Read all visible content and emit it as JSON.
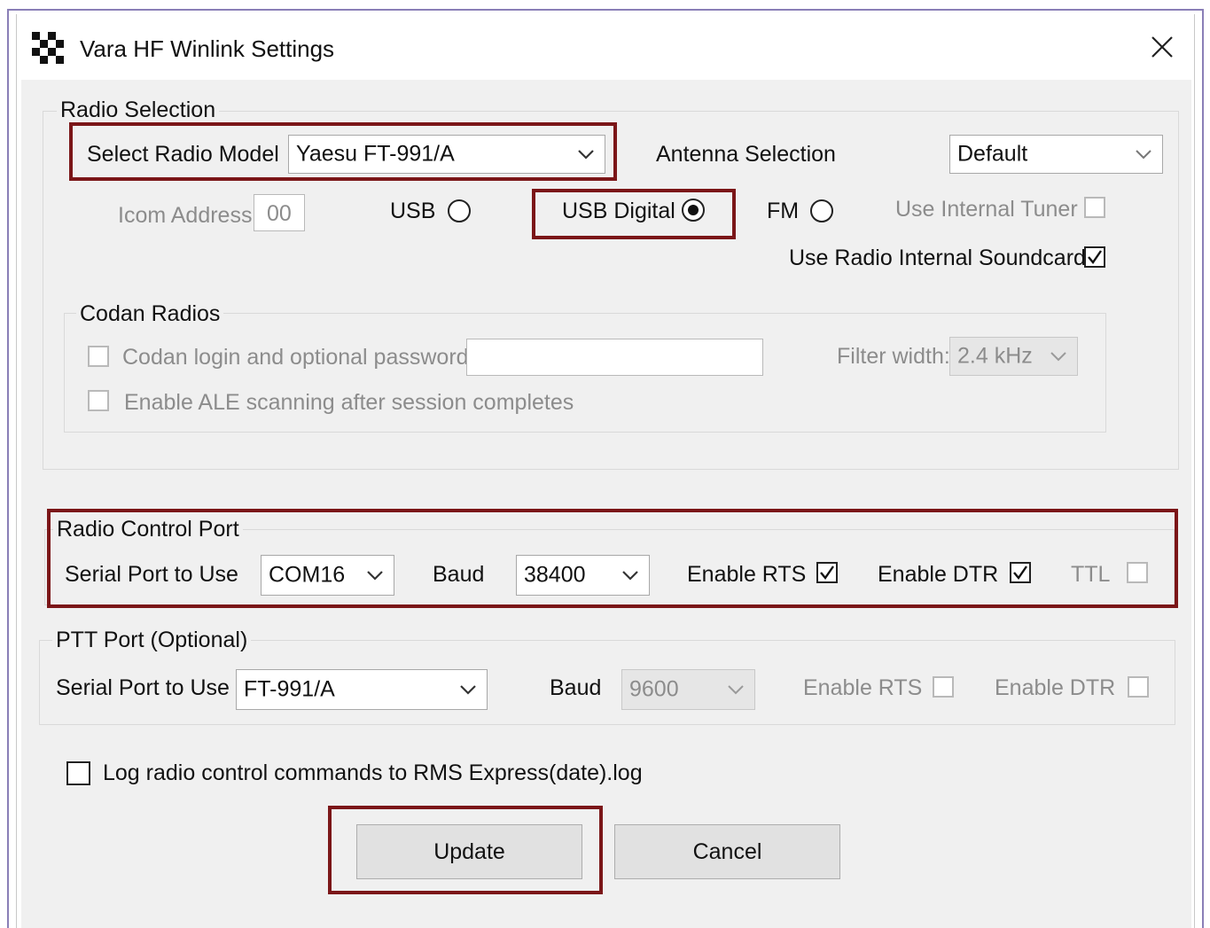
{
  "window": {
    "title": "Vara HF Winlink Settings"
  },
  "radio_selection": {
    "legend": "Radio Selection",
    "model_label": "Select Radio Model",
    "model_value": "Yaesu FT-991/A",
    "antenna_label": "Antenna Selection",
    "antenna_value": "Default",
    "icom_label": "Icom Address",
    "icom_value": "00",
    "usb_label": "USB",
    "usb_digital_label": "USB Digital",
    "fm_label": "FM",
    "internal_tuner_label": "Use Internal Tuner",
    "internal_soundcard_label": "Use Radio Internal Soundcard"
  },
  "codan": {
    "legend": "Codan Radios",
    "login_label": "Codan login and optional password:",
    "filter_label": "Filter width:",
    "filter_value": "2.4 kHz",
    "ale_label": "Enable ALE scanning after session completes"
  },
  "control_port": {
    "legend": "Radio Control Port",
    "serial_label": "Serial Port to Use",
    "serial_value": "COM16",
    "baud_label": "Baud",
    "baud_value": "38400",
    "rts_label": "Enable RTS",
    "dtr_label": "Enable DTR",
    "ttl_label": "TTL"
  },
  "ptt_port": {
    "legend": "PTT Port (Optional)",
    "serial_label": "Serial Port to Use",
    "serial_value": "FT-991/A",
    "baud_label": "Baud",
    "baud_value": "9600",
    "rts_label": "Enable RTS",
    "dtr_label": "Enable DTR"
  },
  "log_label": "Log radio control commands to RMS Express(date).log",
  "buttons": {
    "update": "Update",
    "cancel": "Cancel"
  },
  "colors": {
    "highlight": "#7b1618",
    "dialog_bg": "#f0f0f0"
  }
}
